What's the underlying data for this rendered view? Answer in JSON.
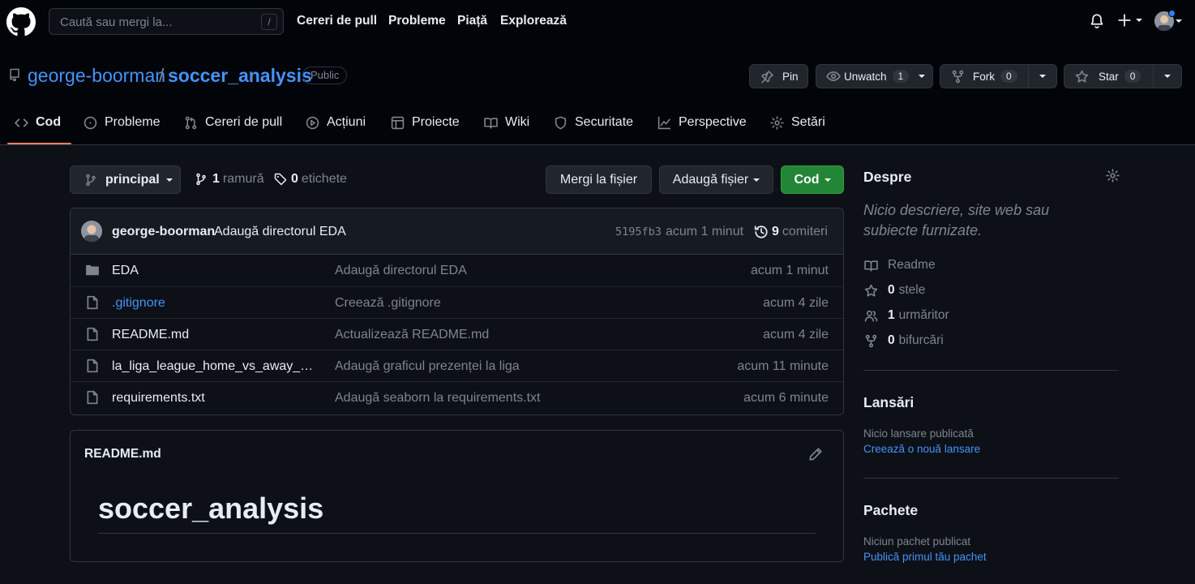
{
  "colors": {
    "bg": "#0d1117",
    "header_bg": "#010409",
    "link": "#4493f8",
    "accent_tab": "#f78166",
    "primary_button": "#238636",
    "muted": "#7d8590",
    "border": "#30363d"
  },
  "header": {
    "search_placeholder": "Caută sau mergi la...",
    "search_shortcut": "/",
    "nav": [
      "Cereri de pull",
      "Probleme",
      "Piață",
      "Explorează"
    ],
    "icons": [
      "github-logo-icon",
      "bell-icon",
      "plus-icon",
      "avatar"
    ]
  },
  "repo": {
    "owner": "george-boorman",
    "separator": "/",
    "name": "soccer_analysis",
    "visibility": "Public",
    "actions": {
      "pin": "Pin",
      "unwatch": "Unwatch",
      "watch_count": "1",
      "fork": "Fork",
      "fork_count": "0",
      "star": "Star",
      "star_count": "0"
    }
  },
  "tabs": [
    {
      "label": "Cod",
      "icon": "code-icon",
      "active": true
    },
    {
      "label": "Probleme",
      "icon": "issue-icon"
    },
    {
      "label": "Cereri de pull",
      "icon": "pull-request-icon"
    },
    {
      "label": "Acțiuni",
      "icon": "play-icon"
    },
    {
      "label": "Proiecte",
      "icon": "table-icon"
    },
    {
      "label": "Wiki",
      "icon": "book-icon"
    },
    {
      "label": "Securitate",
      "icon": "shield-icon"
    },
    {
      "label": "Perspective",
      "icon": "graph-icon"
    },
    {
      "label": "Setări",
      "icon": "gear-icon"
    }
  ],
  "branchbar": {
    "branch": "principal",
    "branch_count": "1",
    "branch_label": "ramură",
    "tag_count": "0",
    "tag_label": "etichete",
    "goto_file": "Mergi la fișier",
    "add_file": "Adaugă fișier",
    "code": "Cod"
  },
  "commit": {
    "author": "george-boorman",
    "message": "Adaugă directorul EDA",
    "sha": "5195fb3",
    "time": "acum 1 minut",
    "count": "9",
    "count_label": "comiteri"
  },
  "files": [
    {
      "name": "EDA",
      "type": "folder",
      "message": "Adaugă directorul EDA",
      "age": "acum 1 minut"
    },
    {
      "name": ".gitignore",
      "type": "file",
      "message": "Creează .gitignore",
      "age": "acum 4 zile",
      "link": true
    },
    {
      "name": "README.md",
      "type": "file",
      "message": "Actualizează README.md",
      "age": "acum 4 zile"
    },
    {
      "name": "la_liga_league_home_vs_away_att...",
      "type": "file",
      "message": "Adaugă graficul prezenței la liga",
      "age": "acum 11 minute"
    },
    {
      "name": "requirements.txt",
      "type": "file",
      "message": "Adaugă seaborn la requirements.txt",
      "age": "acum 6 minute"
    }
  ],
  "readme": {
    "title": "README.md",
    "heading": "soccer_analysis"
  },
  "sidebar": {
    "about_title": "Despre",
    "about_desc": "Nicio descriere, site web sau subiecte furnizate.",
    "readme": "Readme",
    "stars_count": "0",
    "stars_label": "stele",
    "watchers_count": "1",
    "watchers_label": "urmăritor",
    "forks_count": "0",
    "forks_label": "bifurcări",
    "releases_title": "Lansări",
    "releases_note": "Nicio lansare publicată",
    "releases_link": "Creează o nouă lansare",
    "packages_title": "Pachete",
    "packages_note": "Niciun pachet publicat",
    "packages_link": "Publică primul tău pachet"
  }
}
